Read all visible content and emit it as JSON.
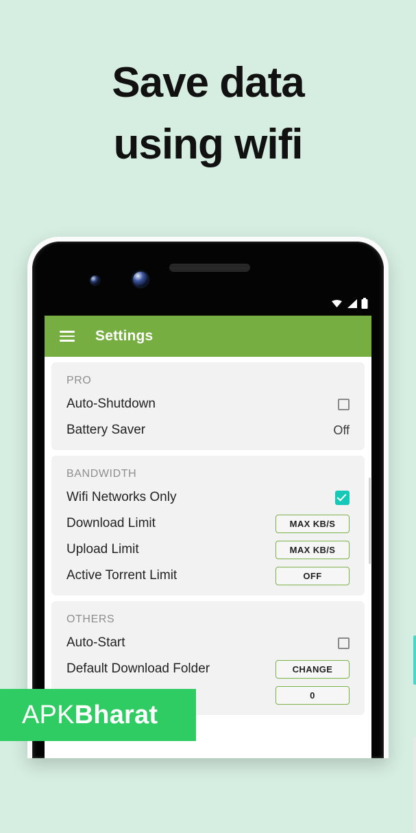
{
  "headline": {
    "line1": "Save data",
    "line2": "using wifi"
  },
  "colors": {
    "background": "#d6eee2",
    "appbar_green": "#76ae41",
    "button_border_green": "#79b147",
    "checkbox_checked_teal": "#16c8b8",
    "watermark_green": "#2ecc62",
    "power_button_teal": "#48d7ca"
  },
  "phone": {
    "status_bar": {
      "wifi_icon": "wifi-icon",
      "signal_icon": "signal-icon",
      "battery_icon": "battery-icon"
    },
    "hardware": {
      "camera_small": "camera-lens-icon",
      "camera_large": "camera-lens-icon",
      "speaker": "speaker-grille",
      "power_button": "power-button",
      "volume_button": "volume-rocker"
    }
  },
  "appbar": {
    "menu_icon": "hamburger-menu-icon",
    "title": "Settings"
  },
  "sections": [
    {
      "title": "PRO",
      "rows": [
        {
          "label": "Auto-Shutdown",
          "control": "checkbox",
          "checked": false
        },
        {
          "label": "Battery Saver",
          "control": "text",
          "value": "Off"
        }
      ]
    },
    {
      "title": "BANDWIDTH",
      "rows": [
        {
          "label": "Wifi Networks Only",
          "control": "checkbox",
          "checked": true
        },
        {
          "label": "Download Limit",
          "control": "button",
          "value": "MAX KB/S"
        },
        {
          "label": "Upload Limit",
          "control": "button",
          "value": "MAX KB/S"
        },
        {
          "label": "Active Torrent Limit",
          "control": "button",
          "value": "OFF"
        }
      ]
    },
    {
      "title": "OTHERS",
      "rows": [
        {
          "label": "Auto-Start",
          "control": "checkbox",
          "checked": false
        },
        {
          "label": "Default Download Folder",
          "control": "button",
          "value": "CHANGE"
        },
        {
          "label": "",
          "control": "button",
          "value": "0"
        }
      ]
    }
  ],
  "watermark": {
    "prefix": "APK",
    "suffix": "Bharat"
  }
}
